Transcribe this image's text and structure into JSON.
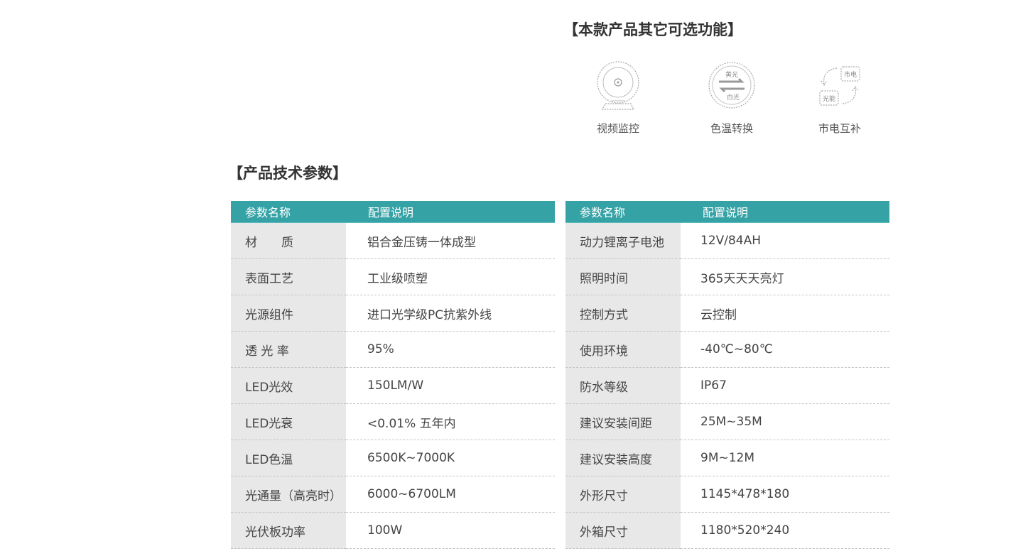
{
  "optional_features": {
    "title": "【本款产品其它可选功能】",
    "items": [
      {
        "label": "视频监控",
        "icon": "camera-icon"
      },
      {
        "label": "色温转换",
        "icon": "color-temperature-icon",
        "icon_text": [
          "黄光",
          "白光"
        ]
      },
      {
        "label": "市电互补",
        "icon": "grid-solar-switch-icon",
        "icon_text": [
          "市电",
          "光能"
        ]
      }
    ]
  },
  "specs": {
    "title": "【产品技术参数】",
    "header": {
      "col1": "参数名称",
      "col2": "配置说明"
    },
    "left_rows": [
      {
        "name": "材　　质",
        "value": "铝合金压铸一体成型"
      },
      {
        "name": "表面工艺",
        "value": "工业级喷塑"
      },
      {
        "name": "光源组件",
        "value": "进口光学级PC抗紫外线"
      },
      {
        "name": "透 光 率",
        "value": "95%"
      },
      {
        "name": "LED光效",
        "value": "150LM/W"
      },
      {
        "name": "LED光衰",
        "value": "<0.01% 五年内"
      },
      {
        "name": "LED色温",
        "value": "6500K~7000K"
      },
      {
        "name": "光通量（高亮时）",
        "value": "6000~6700LM"
      },
      {
        "name": "光伏板功率",
        "value": "100W"
      }
    ],
    "right_rows": [
      {
        "name": "动力锂离子电池",
        "value": "12V/84AH"
      },
      {
        "name": "照明时间",
        "value": "365天天天亮灯"
      },
      {
        "name": "控制方式",
        "value": "云控制"
      },
      {
        "name": "使用环境",
        "value": "-40℃~80℃"
      },
      {
        "name": "防水等级",
        "value": "IP67"
      },
      {
        "name": "建议安装间距",
        "value": "25M~35M"
      },
      {
        "name": "建议安装高度",
        "value": "9M~12M"
      },
      {
        "name": "外形尺寸",
        "value": "1145*478*180"
      },
      {
        "name": "外箱尺寸",
        "value": "1180*520*240"
      }
    ]
  },
  "colors": {
    "header_bg": "#35a2a6",
    "key_cell_bg": "#e8e8e8",
    "icon_gray": "#9a9a9a"
  }
}
